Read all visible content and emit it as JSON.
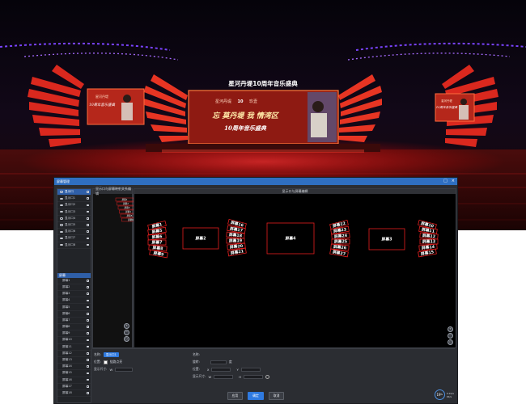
{
  "photo": {
    "stage_title": "星河丹堤10周年音乐盛典",
    "center_screen": {
      "line1": "星河丹堤",
      "line1_badge": "10",
      "line1_tail": "玖壹",
      "line2": "忘 莫丹堤  我 情湾区",
      "line3": "10周年音乐盛典"
    },
    "left_screen": {
      "line1": "星河丹堤",
      "line2": "10周年音乐盛典"
    },
    "right_screen": {
      "line1": "星河丹堤",
      "line2": "10周年音乐盛典"
    }
  },
  "window": {
    "title": "屏幕管理",
    "controls": [
      "□",
      "×"
    ]
  },
  "left_panel": {
    "header": "显示口",
    "outputs": [
      "显示口1",
      "显示口2",
      "显示口3",
      "显示口4",
      "显示口5",
      "显示口6",
      "显示口7",
      "显示口8"
    ],
    "group_header": "屏幕",
    "screens": [
      "屏幕1",
      "屏幕2",
      "屏幕3",
      "屏幕4",
      "屏幕5",
      "屏幕6",
      "屏幕7",
      "屏幕8",
      "屏幕9",
      "屏幕10",
      "屏幕11",
      "屏幕12",
      "屏幕13",
      "屏幕14",
      "屏幕15",
      "屏幕16",
      "屏幕17",
      "屏幕18"
    ]
  },
  "mid_panel": {
    "header": "显示口与屏幕映射关系编辑",
    "mini_labels": [
      "屏幕1",
      "屏幕2",
      "屏幕3",
      "屏幕4",
      "屏幕5",
      "屏幕6"
    ],
    "zoom": [
      "+",
      "−",
      "○"
    ]
  },
  "main_panel": {
    "header": "显示口与屏幕编辑",
    "zoom": [
      "+",
      "−",
      "○"
    ],
    "screens": {
      "big_left": "屏幕2",
      "big_center": "屏幕4",
      "big_right": "屏幕3",
      "left_fan": [
        "屏幕1",
        "屏幕5",
        "屏幕6",
        "屏幕7",
        "屏幕8",
        "屏幕9"
      ],
      "inner_left_fan": [
        "屏幕16",
        "屏幕17",
        "屏幕18",
        "屏幕19",
        "屏幕20",
        "屏幕21"
      ],
      "inner_right_fan": [
        "屏幕22",
        "屏幕23",
        "屏幕24",
        "屏幕25",
        "屏幕26",
        "屏幕27"
      ],
      "right_fan": [
        "屏幕10",
        "屏幕11",
        "屏幕12",
        "屏幕13",
        "屏幕14",
        "屏幕15"
      ]
    }
  },
  "props_left": {
    "name_label": "名称:",
    "name_value": "显示口1",
    "pos_label": "位置:",
    "checkbox_label": "链路点亮",
    "size_label": "显示尺寸:",
    "size_w": "W"
  },
  "props_right": {
    "name_label": "名称:",
    "rotate_label": "旋转:",
    "rotate_unit": "度",
    "pos_label": "位置:",
    "pos_x": "X",
    "pos_y": "Y",
    "size_label": "显示尺寸:",
    "size_w": "W",
    "size_h": "H"
  },
  "footer": {
    "buttons": [
      "应用",
      "确定",
      "取消"
    ]
  },
  "meter": {
    "value": "19",
    "unit": "%",
    "line1": "0.1K/s",
    "line2": "0K/s"
  }
}
